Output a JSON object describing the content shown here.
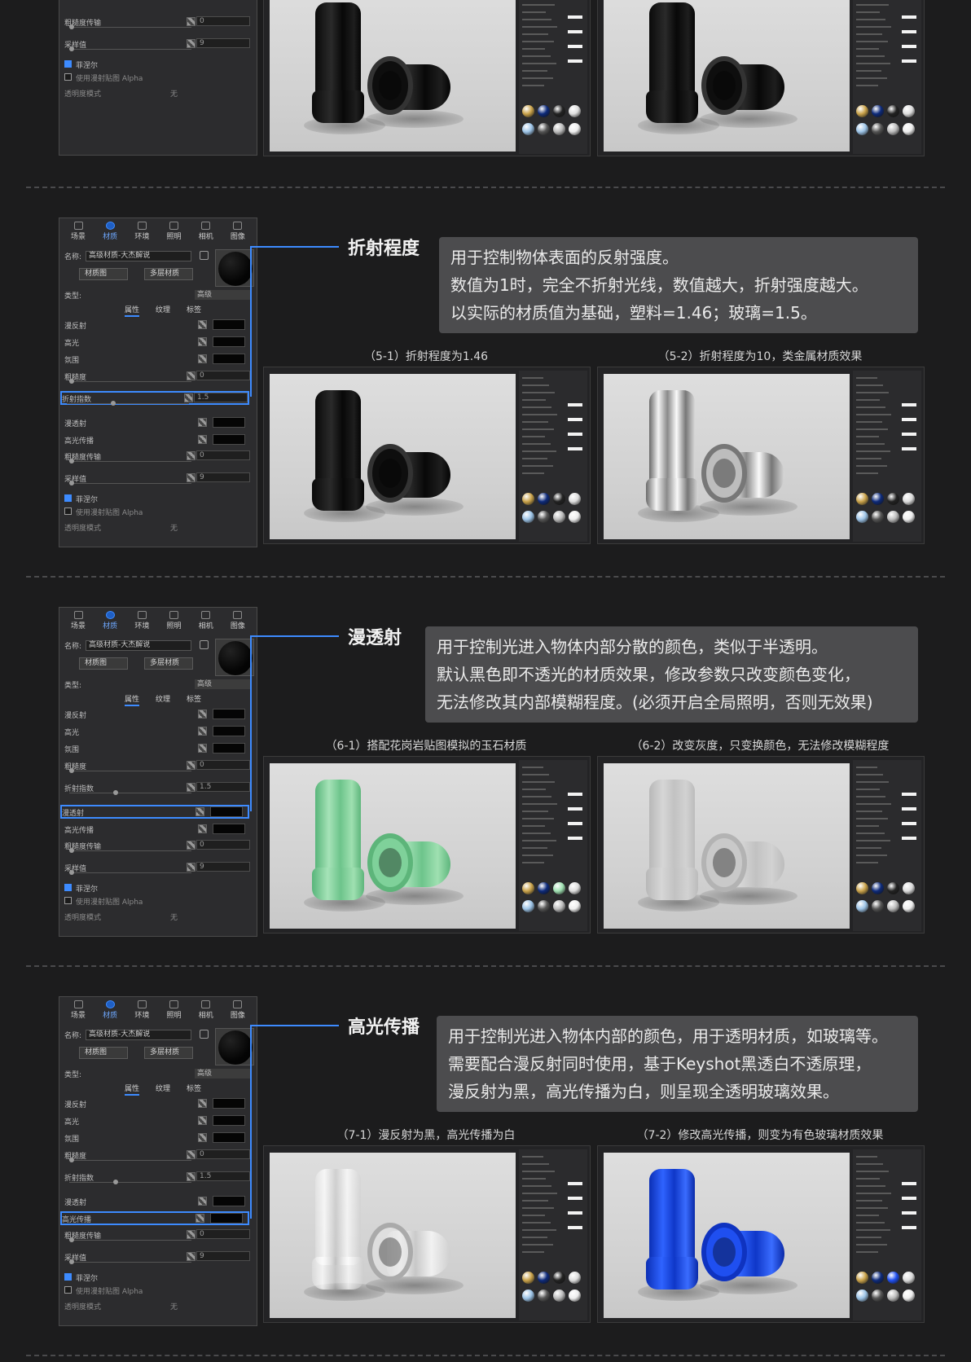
{
  "panel": {
    "tabs": [
      "场景",
      "材质",
      "环境",
      "照明",
      "相机",
      "图像"
    ],
    "name_label": "名称:",
    "name_value": "高级材质-大杰解说",
    "btn_material_graph": "材质图",
    "btn_multilayer": "多层材质",
    "type_label": "类型:",
    "type_value": "高级",
    "subtabs": [
      "属性",
      "纹理",
      "标签"
    ],
    "rows": {
      "diffuse": "漫反射",
      "specular": "高光",
      "ambient": "氛围",
      "roughness": "粗糙度",
      "roughness_val": "0",
      "ior": "折射指数",
      "ior_val": "1.5",
      "translucency": "漫透射",
      "spec_transmission": "高光传播",
      "rough_transmission": "粗糙度传输",
      "rough_transmission_val": "0",
      "samples": "采样值",
      "samples_val": "9",
      "fresnel": "菲涅尔",
      "use_alpha": "使用漫射贴图 Alpha",
      "transparency_mode": "透明度模式",
      "transparency_val": "无"
    }
  },
  "sections": [
    {
      "title": "折射程度",
      "desc": [
        "用于控制物体表面的反射强度。",
        "数值为1时，完全不折射光线，数值越大，折射强度越大。",
        "以实际的材质值为基础，塑料=1.46；玻璃=1.5。"
      ],
      "captions": [
        "（5-1）折射程度为1.46",
        "（5-2）折射程度为10，类金属材质效果"
      ]
    },
    {
      "title": "漫透射",
      "desc": [
        "用于控制光进入物体内部分散的颜色，类似于半透明。",
        "默认黑色即不透光的材质效果，修改参数只改变颜色变化，",
        "无法修改其内部模糊程度。(必须开启全局照明，否则无效果)"
      ],
      "captions": [
        "（6-1）搭配花岗岩贴图模拟的玉石材质",
        "（6-2）改变灰度，只变换颜色，无法修改模糊程度"
      ]
    },
    {
      "title": "高光传播",
      "desc": [
        "用于控制光进入物体内部的颜色，用于透明材质，如玻璃等。",
        "需要配合漫反射同时使用，基于Keyshot黑透白不透原理，",
        "漫反射为黑，高光传播为白，则呈现全透明玻璃效果。"
      ],
      "captions": [
        "（7-1）漫反射为黑，高光传播为白",
        "（7-2）修改高光传播，则变为有色玻璃材质效果"
      ]
    }
  ],
  "colors": {
    "accent": "#3d8bff",
    "background": "#1c1c1d",
    "desc_box": "#4c4c4e"
  }
}
